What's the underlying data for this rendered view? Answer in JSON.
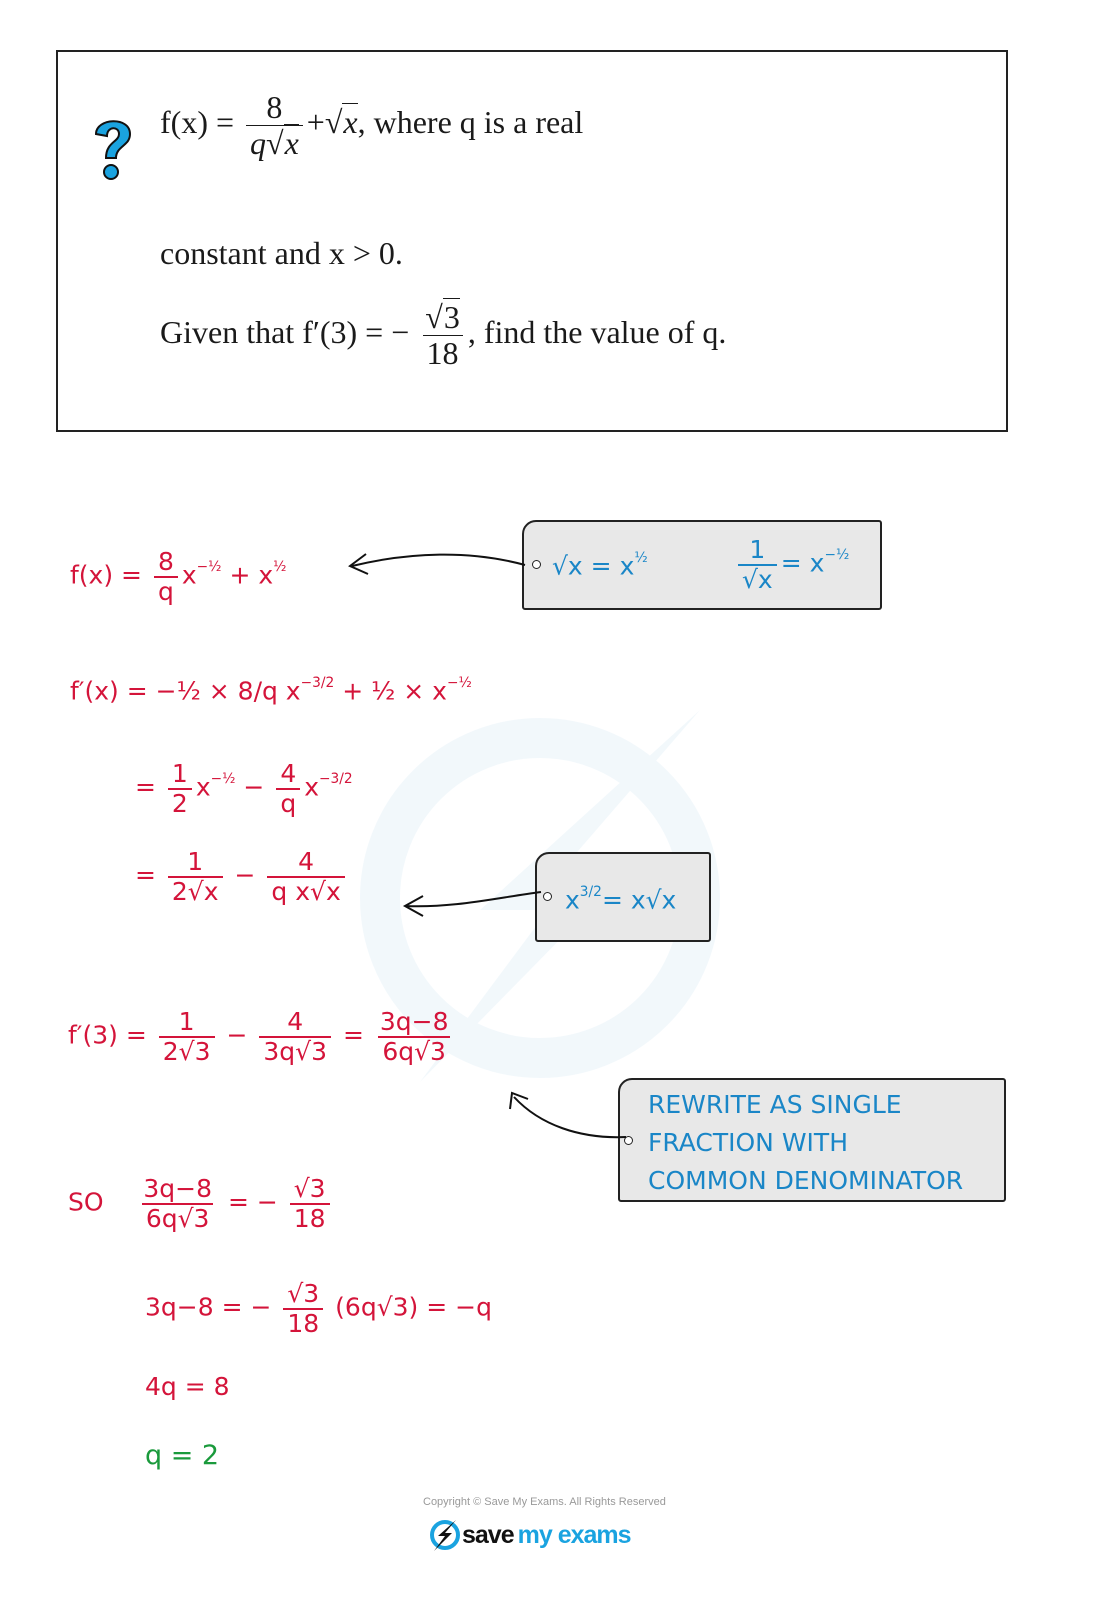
{
  "question": {
    "icon": "question-mark-icon",
    "line1": {
      "prefix": "f(x) = ",
      "frac_num": "8",
      "frac_den_q": "q",
      "frac_den_x": "x",
      "plus": "+",
      "sqrt_x": "x",
      "suffix": ", where q is a real"
    },
    "line2": "constant and x > 0.",
    "line3": {
      "prefix": "Given that f′(3) = −",
      "frac_num": "3",
      "frac_den": "18",
      "suffix": ", find the value of q."
    }
  },
  "solution": {
    "step1": {
      "lhs": "f(x) =",
      "c_num": "8",
      "c_den": "q",
      "x": "x",
      "exp1": "−½",
      "plus": "+",
      "exp2": "½"
    },
    "note1": {
      "left": "√x = x",
      "left_exp": "½",
      "right_num": "1",
      "right_den": "√x",
      "right_eq": "= x",
      "right_exp": "−½"
    },
    "step2": {
      "lhs": "f′(x) =",
      "text": "−½ × 8/q x",
      "exp1": "−3/2",
      "mid": "+ ½ × x",
      "exp2": "−½"
    },
    "step3": {
      "eq": "=",
      "a_num": "1",
      "a_den": "2",
      "exp1": "−½",
      "minus": "−",
      "b_num": "4",
      "b_den": "q",
      "exp2": "−3/2"
    },
    "step4": {
      "eq": "=",
      "a_num": "1",
      "a_den": "2√x",
      "minus": "−",
      "b_num": "4",
      "b_den": "q x√x"
    },
    "note2": {
      "text": "x",
      "exp": "3/2",
      "rhs": "= x√x"
    },
    "step5": {
      "lhs": "f′(3) =",
      "a_num": "1",
      "a_den": "2√3",
      "minus": "−",
      "b_num": "4",
      "b_den": "3q√3",
      "eq": "=",
      "c_num": "3q−8",
      "c_den": "6q√3"
    },
    "note3": {
      "lines": [
        "REWRITE  AS  SINGLE",
        "FRACTION  WITH",
        "COMMON  DENOMINATOR"
      ]
    },
    "step6": {
      "so": "SO",
      "a_num": "3q−8",
      "a_den": "6q√3",
      "eq": "= −",
      "b_num": "√3",
      "b_den": "18"
    },
    "step7": {
      "lhs": "3q−8 = −",
      "f_num": "√3",
      "f_den": "18",
      "paren": "(6q√3)",
      "rhs": "= −q"
    },
    "step8": "4q = 8",
    "answer": "q = 2"
  },
  "footer": {
    "copyright": "Copyright © Save My Exams. All Rights Reserved",
    "brand_a": "save",
    "brand_b": "my exams"
  },
  "colors": {
    "working": "#d4143a",
    "note_text": "#1a86c7",
    "answer": "#1a9a3c",
    "icon": "#1aa3e0"
  }
}
